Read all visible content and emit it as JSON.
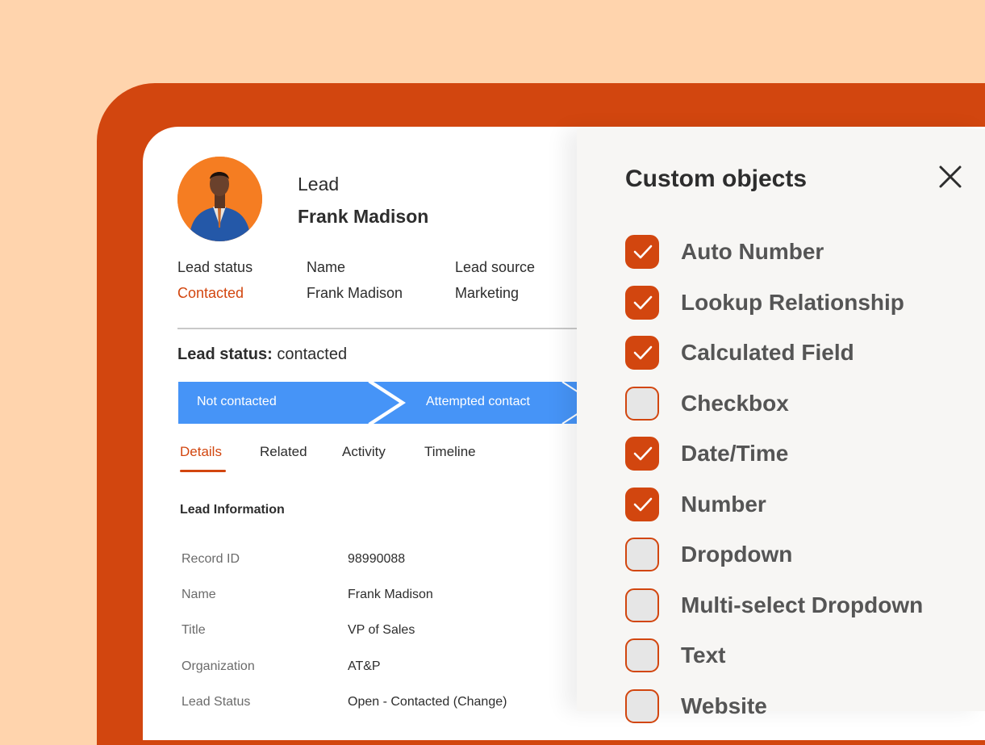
{
  "lead": {
    "kicker": "Lead",
    "name": "Frank Madison"
  },
  "summary": [
    {
      "label": "Lead status",
      "value": "Contacted"
    },
    {
      "label": "Name",
      "value": "Frank Madison"
    },
    {
      "label": "Lead source",
      "value": "Marketing"
    }
  ],
  "status_line": {
    "label": "Lead status:",
    "value": "contacted"
  },
  "pipeline": {
    "stages": [
      "Not contacted",
      "Attempted contact"
    ]
  },
  "tabs": [
    "Details",
    "Related",
    "Activity",
    "Timeline"
  ],
  "active_tab": "Details",
  "section_title": "Lead Information",
  "fields": [
    {
      "label": "Record ID",
      "value": "98990088"
    },
    {
      "label": "Name",
      "value": "Frank Madison"
    },
    {
      "label": "Title",
      "value": "VP of Sales"
    },
    {
      "label": "Organization",
      "value": "AT&P"
    },
    {
      "label": "Lead Status",
      "value": "Open - Contacted (Change)"
    }
  ],
  "panel": {
    "title": "Custom objects",
    "close_icon": "close-icon",
    "options": [
      {
        "label": "Auto Number",
        "checked": true
      },
      {
        "label": "Lookup Relationship",
        "checked": true
      },
      {
        "label": "Calculated Field",
        "checked": true
      },
      {
        "label": "Checkbox",
        "checked": false
      },
      {
        "label": "Date/Time",
        "checked": true
      },
      {
        "label": "Number",
        "checked": true
      },
      {
        "label": "Dropdown",
        "checked": false
      },
      {
        "label": "Multi-select Dropdown",
        "checked": false
      },
      {
        "label": "Text",
        "checked": false
      },
      {
        "label": "Website",
        "checked": false
      }
    ]
  },
  "colors": {
    "accent": "#d2460f",
    "pipeline_blue": "#4694f7",
    "background": "#ffd4ad"
  }
}
